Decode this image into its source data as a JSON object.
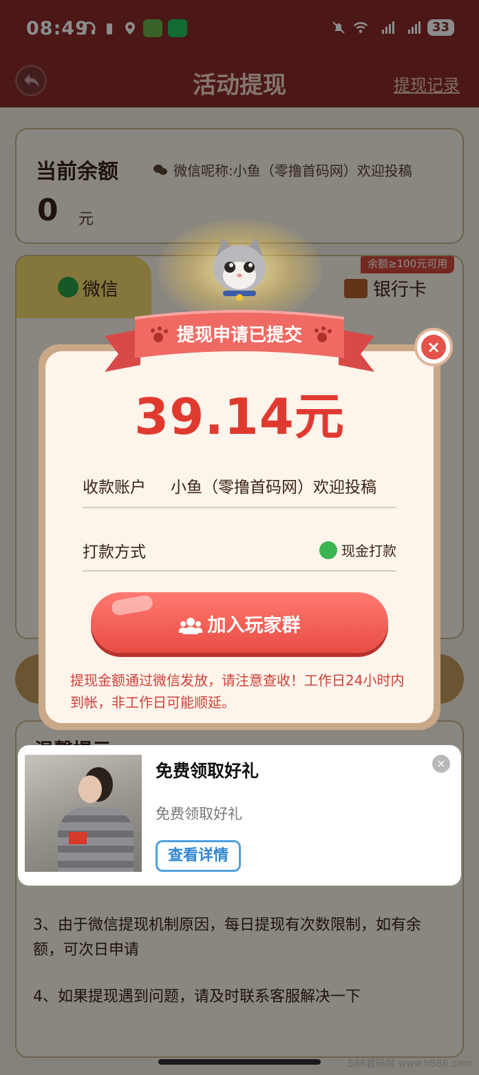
{
  "status": {
    "time": "08:49",
    "battery": "33"
  },
  "header": {
    "title": "活动提现",
    "records": "提现记录"
  },
  "balance": {
    "label": "当前余额",
    "nickname": "微信呢称:小鱼（零撸首码网）欢迎投稿",
    "amount": "0",
    "unit": "元"
  },
  "methods": {
    "wechat": "微信",
    "bank": "银行卡",
    "bank_badge": "余额≥100元可用"
  },
  "tips": {
    "title": "温馨提示",
    "items": [
      "3、由于微信提现机制原因，每日提现有次数限制，如有余额，可次日申请",
      "4、如果提现遇到问题，请及时联系客服解决一下"
    ]
  },
  "dialog": {
    "banner": "提现申请已提交",
    "amount": "39.14元",
    "account_label": "收款账户",
    "account_value": "小鱼（零撸首码网）欢迎投稿",
    "pay_label": "打款方式",
    "pay_value": "现金打款",
    "join_button": "加入玩家群",
    "notice": "提现金额通过微信发放，请注意查收！工作日24小时内到帐，非工作日可能顺延。",
    "close": "×"
  },
  "ad": {
    "title": "免费领取好礼",
    "subtitle": "免费领取好礼",
    "button": "查看详情",
    "close": "×"
  },
  "watermark": "586首码网 www.h586.com",
  "colors": {
    "header": "#8a2a2a",
    "accent_red": "#e03a30",
    "button_red": "#e84c44",
    "wechat_green": "#2ba246",
    "ad_blue": "#4da0e0"
  }
}
